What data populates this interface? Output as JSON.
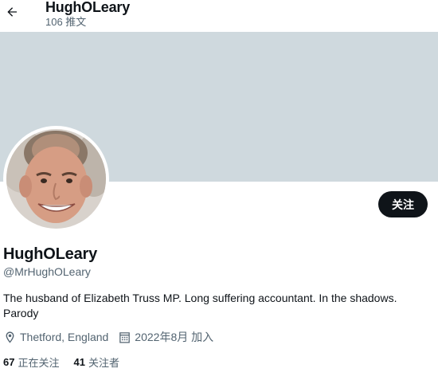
{
  "header": {
    "name": "HughOLeary",
    "tweet_count": "106 推文"
  },
  "profile": {
    "banner_color": "#cfd9de",
    "follow_label": "关注",
    "display_name": "HughOLeary",
    "handle": "@MrHughOLeary",
    "bio": "The husband of Elizabeth Truss MP. Long suffering accountant. In the shadows. Parody",
    "location": "Thetford, England",
    "joined": "2022年8月 加入",
    "following_count": "67",
    "following_label": "正在关注",
    "followers_count": "41",
    "followers_label": "关注者"
  },
  "icons": {
    "back": "arrow-left-icon",
    "location": "location-pin-icon",
    "calendar": "calendar-icon"
  }
}
